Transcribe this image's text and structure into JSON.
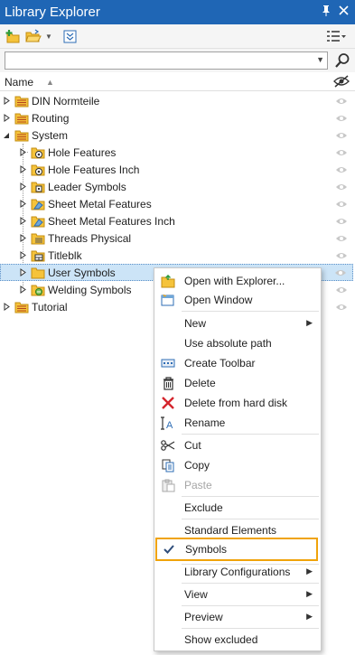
{
  "window": {
    "title": "Library Explorer",
    "pin_glyph": "⟟",
    "close_glyph": "✕"
  },
  "toolbar": {
    "icons": [
      "add-library-icon",
      "open-folder-icon",
      "dropdown-icon",
      "collapse-icon",
      "view-options-icon"
    ]
  },
  "search": {
    "value": "",
    "placeholder": ""
  },
  "columns": {
    "name": "Name"
  },
  "tree": [
    {
      "label": "DIN Normteile",
      "level": 0,
      "expander": "collapsed"
    },
    {
      "label": "Routing",
      "level": 0,
      "expander": "collapsed"
    },
    {
      "label": "System",
      "level": 0,
      "expander": "expanded"
    },
    {
      "label": "Hole Features",
      "level": 1,
      "expander": "collapsed"
    },
    {
      "label": "Hole Features Inch",
      "level": 1,
      "expander": "collapsed"
    },
    {
      "label": "Leader Symbols",
      "level": 1,
      "expander": "collapsed"
    },
    {
      "label": "Sheet Metal Features",
      "level": 1,
      "expander": "collapsed"
    },
    {
      "label": "Sheet Metal Features Inch",
      "level": 1,
      "expander": "collapsed"
    },
    {
      "label": "Threads Physical",
      "level": 1,
      "expander": "collapsed"
    },
    {
      "label": "Titleblk",
      "level": 1,
      "expander": "collapsed"
    },
    {
      "label": "User Symbols",
      "level": 1,
      "expander": "collapsed",
      "selected": true
    },
    {
      "label": "Welding Symbols",
      "level": 1,
      "expander": "collapsed"
    },
    {
      "label": "Tutorial",
      "level": 0,
      "expander": "collapsed"
    }
  ],
  "context_menu": {
    "open_with_explorer": "Open with Explorer...",
    "open_window": "Open Window",
    "new": "New",
    "use_absolute_path": "Use absolute path",
    "create_toolbar": "Create Toolbar",
    "delete": "Delete",
    "delete_from_hard_disk": "Delete from hard disk",
    "rename": "Rename",
    "cut": "Cut",
    "copy": "Copy",
    "paste": "Paste",
    "exclude": "Exclude",
    "standard_elements": "Standard Elements",
    "symbols": "Symbols",
    "library_configurations": "Library Configurations",
    "view": "View",
    "preview": "Preview",
    "show_excluded": "Show excluded"
  },
  "colors": {
    "accent": "#1f66b5",
    "selection": "#cce4f7",
    "highlight": "#f0a30a",
    "folder": "#f5c33b",
    "delete_red": "#d4252d"
  }
}
